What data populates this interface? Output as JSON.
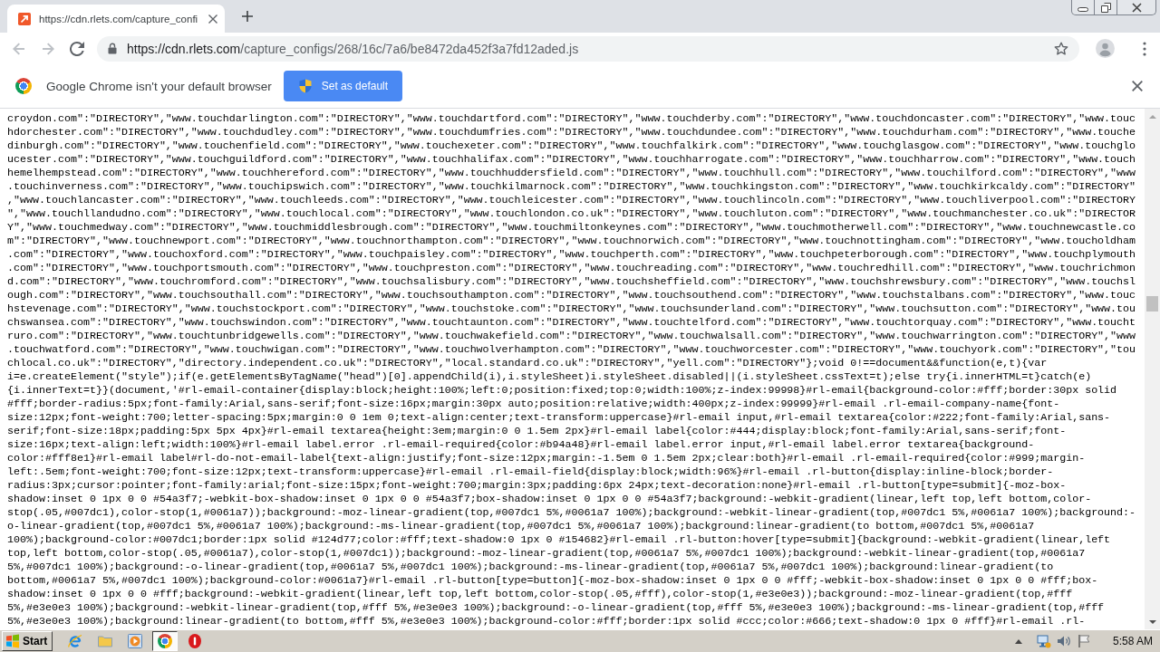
{
  "tab_strip": {
    "tabs": [
      {
        "title": "https://cdn.rlets.com/capture_confi",
        "selected": true
      }
    ]
  },
  "toolbar": {
    "nav_buttons": [
      {
        "kind": "back",
        "disabled": true
      },
      {
        "kind": "forward",
        "disabled": true
      },
      {
        "kind": "reload",
        "disabled": false
      }
    ],
    "address": {
      "origin": "https://cdn.rlets.com",
      "path": "/capture_configs/268/16c/7a6/be8472da452f3a7fd12aded.js"
    }
  },
  "infobar": {
    "message": "Google Chrome isn't your default browser",
    "button": "Set as default"
  },
  "page_text": {
    "lines": [
      "croydon.com\":\"DIRECTORY\",\"www.touchdarlington.com\":\"DIRECTORY\",\"www.touchdartford.com\":\"DIRECTORY\",\"www.touchderby.com\":\"DIRECTORY\",\"www.touchdoncaster.com\":\"DIRECTORY\",\"www.touc",
      "hdorchester.com\":\"DIRECTORY\",\"www.touchdudley.com\":\"DIRECTORY\",\"www.touchdumfries.com\":\"DIRECTORY\",\"www.touchdundee.com\":\"DIRECTORY\",\"www.touchdurham.com\":\"DIRECTORY\",\"www.touche",
      "dinburgh.com\":\"DIRECTORY\",\"www.touchenfield.com\":\"DIRECTORY\",\"www.touchexeter.com\":\"DIRECTORY\",\"www.touchfalkirk.com\":\"DIRECTORY\",\"www.touchglasgow.com\":\"DIRECTORY\",\"www.touchglo",
      "ucester.com\":\"DIRECTORY\",\"www.touchguildford.com\":\"DIRECTORY\",\"www.touchhalifax.com\":\"DIRECTORY\",\"www.touchharrogate.com\":\"DIRECTORY\",\"www.touchharrow.com\":\"DIRECTORY\",\"www.touch",
      "hemelhempstead.com\":\"DIRECTORY\",\"www.touchhereford.com\":\"DIRECTORY\",\"www.touchhuddersfield.com\":\"DIRECTORY\",\"www.touchhull.com\":\"DIRECTORY\",\"www.touchilford.com\":\"DIRECTORY\",\"www",
      ".touchinverness.com\":\"DIRECTORY\",\"www.touchipswich.com\":\"DIRECTORY\",\"www.touchkilmarnock.com\":\"DIRECTORY\",\"www.touchkingston.com\":\"DIRECTORY\",\"www.touchkirkcaldy.com\":\"DIRECTORY\"",
      ",\"www.touchlancaster.com\":\"DIRECTORY\",\"www.touchleeds.com\":\"DIRECTORY\",\"www.touchleicester.com\":\"DIRECTORY\",\"www.touchlincoln.com\":\"DIRECTORY\",\"www.touchliverpool.com\":\"DIRECTORY",
      "\",\"www.touchllandudno.com\":\"DIRECTORY\",\"www.touchlocal.com\":\"DIRECTORY\",\"www.touchlondon.co.uk\":\"DIRECTORY\",\"www.touchluton.com\":\"DIRECTORY\",\"www.touchmanchester.co.uk\":\"DIRECTOR",
      "Y\",\"www.touchmedway.com\":\"DIRECTORY\",\"www.touchmiddlesbrough.com\":\"DIRECTORY\",\"www.touchmiltonkeynes.com\":\"DIRECTORY\",\"www.touchmotherwell.com\":\"DIRECTORY\",\"www.touchnewcastle.co",
      "m\":\"DIRECTORY\",\"www.touchnewport.com\":\"DIRECTORY\",\"www.touchnorthampton.com\":\"DIRECTORY\",\"www.touchnorwich.com\":\"DIRECTORY\",\"www.touchnottingham.com\":\"DIRECTORY\",\"www.toucholdham",
      ".com\":\"DIRECTORY\",\"www.touchoxford.com\":\"DIRECTORY\",\"www.touchpaisley.com\":\"DIRECTORY\",\"www.touchperth.com\":\"DIRECTORY\",\"www.touchpeterborough.com\":\"DIRECTORY\",\"www.touchplymouth",
      ".com\":\"DIRECTORY\",\"www.touchportsmouth.com\":\"DIRECTORY\",\"www.touchpreston.com\":\"DIRECTORY\",\"www.touchreading.com\":\"DIRECTORY\",\"www.touchredhill.com\":\"DIRECTORY\",\"www.touchrichmon",
      "d.com\":\"DIRECTORY\",\"www.touchromford.com\":\"DIRECTORY\",\"www.touchsalisbury.com\":\"DIRECTORY\",\"www.touchsheffield.com\":\"DIRECTORY\",\"www.touchshrewsbury.com\":\"DIRECTORY\",\"www.touchsl",
      "ough.com\":\"DIRECTORY\",\"www.touchsouthall.com\":\"DIRECTORY\",\"www.touchsouthampton.com\":\"DIRECTORY\",\"www.touchsouthend.com\":\"DIRECTORY\",\"www.touchstalbans.com\":\"DIRECTORY\",\"www.touc",
      "hstevenage.com\":\"DIRECTORY\",\"www.touchstockport.com\":\"DIRECTORY\",\"www.touchstoke.com\":\"DIRECTORY\",\"www.touchsunderland.com\":\"DIRECTORY\",\"www.touchsutton.com\":\"DIRECTORY\",\"www.tou",
      "chswansea.com\":\"DIRECTORY\",\"www.touchswindon.com\":\"DIRECTORY\",\"www.touchtaunton.com\":\"DIRECTORY\",\"www.touchtelford.com\":\"DIRECTORY\",\"www.touchtorquay.com\":\"DIRECTORY\",\"www.toucht",
      "ruro.com\":\"DIRECTORY\",\"www.touchtunbridgewells.com\":\"DIRECTORY\",\"www.touchwakefield.com\":\"DIRECTORY\",\"www.touchwalsall.com\":\"DIRECTORY\",\"www.touchwarrington.com\":\"DIRECTORY\",\"www",
      ".touchwatford.com\":\"DIRECTORY\",\"www.touchwigan.com\":\"DIRECTORY\",\"www.touchwolverhampton.com\":\"DIRECTORY\",\"www.touchworcester.com\":\"DIRECTORY\",\"www.touchyork.com\":\"DIRECTORY\",\"tou",
      "chlocal.co.uk\":\"DIRECTORY\",\"directory.independent.co.uk\":\"DIRECTORY\",\"local.standard.co.uk\":\"DIRECTORY\",\"yell.com\":\"DIRECTORY\"};void 0!==document&&function(e,t){var",
      "i=e.createElement(\"style\");if(e.getElementsByTagName(\"head\")[0].appendChild(i),i.styleSheet)i.styleSheet.disabled||(i.styleSheet.cssText=t);else try{i.innerHTML=t}catch(e)",
      "{i.innerText=t}}(document,'#rl-email-container{display:block;height:100%;left:0;position:fixed;top:0;width:100%;z-index:99998}#rl-email{background-color:#fff;border:30px solid",
      "#fff;border-radius:5px;font-family:Arial,sans-serif;font-size:16px;margin:30px auto;position:relative;width:400px;z-index:99999}#rl-email .rl-email-company-name{font-",
      "size:12px;font-weight:700;letter-spacing:5px;margin:0 0 1em 0;text-align:center;text-transform:uppercase}#rl-email input,#rl-email textarea{color:#222;font-family:Arial,sans-",
      "serif;font-size:18px;padding:5px 5px 4px}#rl-email textarea{height:3em;margin:0 0 1.5em 2px}#rl-email label{color:#444;display:block;font-family:Arial,sans-serif;font-",
      "size:16px;text-align:left;width:100%}#rl-email label.error .rl-email-required{color:#b94a48}#rl-email label.error input,#rl-email label.error textarea{background-",
      "color:#fff8e1}#rl-email label#rl-do-not-email-label{text-align:justify;font-size:12px;margin:-1.5em 0 1.5em 2px;clear:both}#rl-email .rl-email-required{color:#999;margin-",
      "left:.5em;font-weight:700;font-size:12px;text-transform:uppercase}#rl-email .rl-email-field{display:block;width:96%}#rl-email .rl-button{display:inline-block;border-",
      "radius:3px;cursor:pointer;font-family:arial;font-size:15px;font-weight:700;margin:3px;padding:6px 24px;text-decoration:none}#rl-email .rl-button[type=submit]{-moz-box-",
      "shadow:inset 0 1px 0 0 #54a3f7;-webkit-box-shadow:inset 0 1px 0 0 #54a3f7;box-shadow:inset 0 1px 0 0 #54a3f7;background:-webkit-gradient(linear,left top,left bottom,color-",
      "stop(.05,#007dc1),color-stop(1,#0061a7));background:-moz-linear-gradient(top,#007dc1 5%,#0061a7 100%);background:-webkit-linear-gradient(top,#007dc1 5%,#0061a7 100%);background:-",
      "o-linear-gradient(top,#007dc1 5%,#0061a7 100%);background:-ms-linear-gradient(top,#007dc1 5%,#0061a7 100%);background:linear-gradient(to bottom,#007dc1 5%,#0061a7",
      "100%);background-color:#007dc1;border:1px solid #124d77;color:#fff;text-shadow:0 1px 0 #154682}#rl-email .rl-button:hover[type=submit]{background:-webkit-gradient(linear,left",
      "top,left bottom,color-stop(.05,#0061a7),color-stop(1,#007dc1));background:-moz-linear-gradient(top,#0061a7 5%,#007dc1 100%);background:-webkit-linear-gradient(top,#0061a7",
      "5%,#007dc1 100%);background:-o-linear-gradient(top,#0061a7 5%,#007dc1 100%);background:-ms-linear-gradient(top,#0061a7 5%,#007dc1 100%);background:linear-gradient(to",
      "bottom,#0061a7 5%,#007dc1 100%);background-color:#0061a7}#rl-email .rl-button[type=button]{-moz-box-shadow:inset 0 1px 0 0 #fff;-webkit-box-shadow:inset 0 1px 0 0 #fff;box-",
      "shadow:inset 0 1px 0 0 #fff;background:-webkit-gradient(linear,left top,left bottom,color-stop(.05,#fff),color-stop(1,#e3e0e3));background:-moz-linear-gradient(top,#fff",
      "5%,#e3e0e3 100%);background:-webkit-linear-gradient(top,#fff 5%,#e3e0e3 100%);background:-o-linear-gradient(top,#fff 5%,#e3e0e3 100%);background:-ms-linear-gradient(top,#fff",
      "5%,#e3e0e3 100%);background:linear-gradient(to bottom,#fff 5%,#e3e0e3 100%);background-color:#fff;border:1px solid #ccc;color:#666;text-shadow:0 1px 0 #fff}#rl-email .rl-"
    ]
  },
  "taskbar": {
    "start": "Start",
    "apps": [
      {
        "kind": "ie",
        "selected": false
      },
      {
        "kind": "folder",
        "selected": false
      },
      {
        "kind": "media",
        "selected": false
      },
      {
        "kind": "chrome",
        "selected": true
      },
      {
        "kind": "alert",
        "selected": false
      }
    ],
    "clock": "5:58 AM"
  }
}
